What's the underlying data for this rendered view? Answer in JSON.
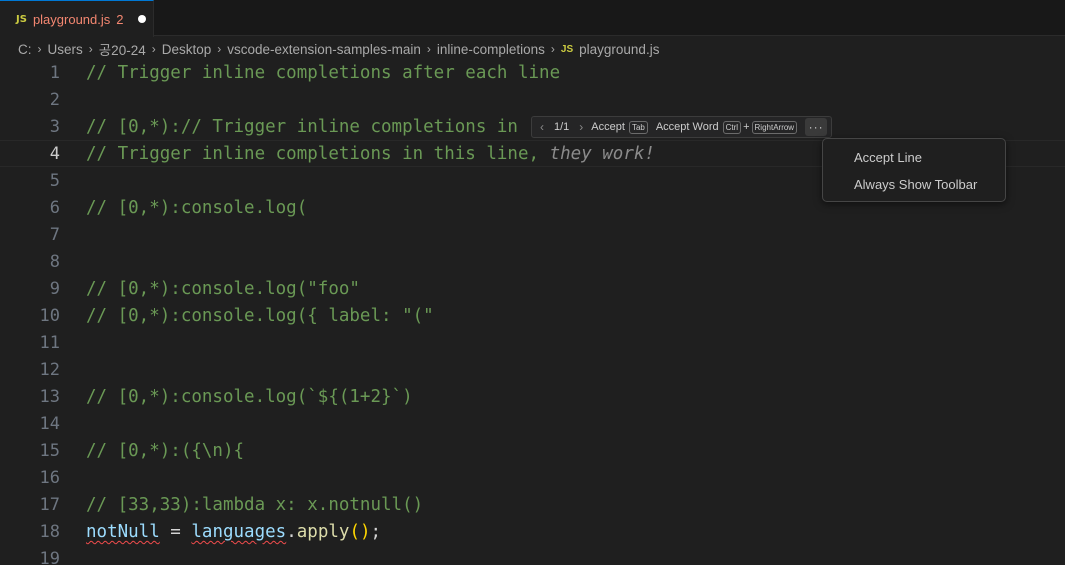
{
  "tab": {
    "icon": "JS",
    "file_name": "playground.js",
    "problem_count": "2",
    "dirty_indicator": "unsaved-dot-icon"
  },
  "breadcrumb": {
    "items": [
      "C:",
      "Users",
      "공20-24",
      "Desktop",
      "vscode-extension-samples-main",
      "inline-completions"
    ],
    "file_icon": "JS",
    "file_name": "playground.js"
  },
  "editor": {
    "current_line": 4,
    "lines": [
      {
        "n": "1",
        "text": "// Trigger inline completions after each line"
      },
      {
        "n": "2",
        "text": ""
      },
      {
        "n": "3",
        "text": "// [0,*):// Trigger inline completions in"
      },
      {
        "n": "4",
        "text": "// Trigger inline completions in this line,",
        "ghost": " they work!"
      },
      {
        "n": "5",
        "text": ""
      },
      {
        "n": "6",
        "text": "// [0,*):console.log("
      },
      {
        "n": "7",
        "text": ""
      },
      {
        "n": "8",
        "text": ""
      },
      {
        "n": "9",
        "text": "// [0,*):console.log(\"foo\""
      },
      {
        "n": "10",
        "text": "// [0,*):console.log({ label: \"(\""
      },
      {
        "n": "11",
        "text": ""
      },
      {
        "n": "12",
        "text": ""
      },
      {
        "n": "13",
        "text": "// [0,*):console.log(`${(1+2}`)"
      },
      {
        "n": "14",
        "text": ""
      },
      {
        "n": "15",
        "text": "// [0,*):({\\n){"
      },
      {
        "n": "16",
        "text": ""
      },
      {
        "n": "17",
        "text": "// [33,33):lambda x: x.notnull()"
      },
      {
        "n": "18",
        "tokens": {
          "var1": "notNull",
          "op": " = ",
          "var2": "languages",
          "dot": ".",
          "fn": "apply",
          "paren": "()",
          "semi": ";"
        }
      },
      {
        "n": "19",
        "text": ""
      }
    ]
  },
  "inline_toolbar": {
    "prev_icon": "chevron-left-icon",
    "next_icon": "chevron-right-icon",
    "counter": "1/1",
    "accept_label": "Accept",
    "accept_key": "Tab",
    "accept_word_label": "Accept Word",
    "accept_word_key1": "Ctrl",
    "accept_word_plus": "+",
    "accept_word_key2": "RightArrow",
    "more_icon": "ellipsis-icon"
  },
  "menu": {
    "items": [
      "Accept Line",
      "Always Show Toolbar"
    ]
  }
}
